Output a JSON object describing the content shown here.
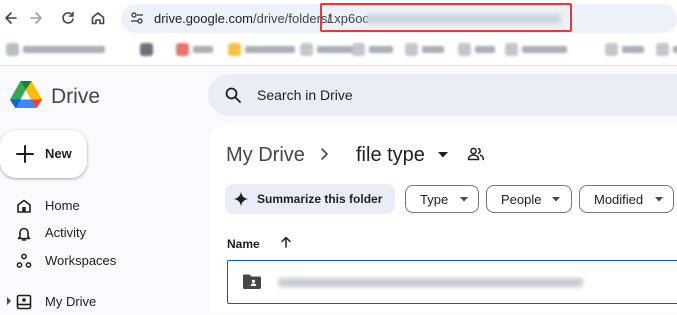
{
  "browser": {
    "url_host": "drive.google.com",
    "url_path": "/drive/folders/",
    "url_folder_id_visible": "1xp6oc",
    "icons": [
      "back-arrow-icon",
      "forward-arrow-icon",
      "reload-icon",
      "home-icon",
      "site-info-icon"
    ]
  },
  "app": {
    "brand": "Drive",
    "new_label": "New"
  },
  "search": {
    "placeholder": "Search in Drive"
  },
  "sidebar": {
    "items": [
      {
        "label": "Home",
        "icon": "home-icon"
      },
      {
        "label": "Activity",
        "icon": "bell-icon"
      },
      {
        "label": "Workspaces",
        "icon": "workspaces-icon"
      },
      {
        "label": "My Drive",
        "icon": "my-drive-icon"
      }
    ]
  },
  "breadcrumb": {
    "root": "My Drive",
    "current": "file type"
  },
  "toolbar": {
    "summarize_label": "Summarize this folder",
    "filters": [
      {
        "label": "Type"
      },
      {
        "label": "People"
      },
      {
        "label": "Modified"
      }
    ]
  },
  "file_list": {
    "name_header": "Name",
    "sort": "ascending"
  },
  "colors": {
    "accent": "#0b57d0",
    "highlight": "#e53935",
    "surface": "#f8fafd",
    "search_bg": "#e9eef6"
  }
}
